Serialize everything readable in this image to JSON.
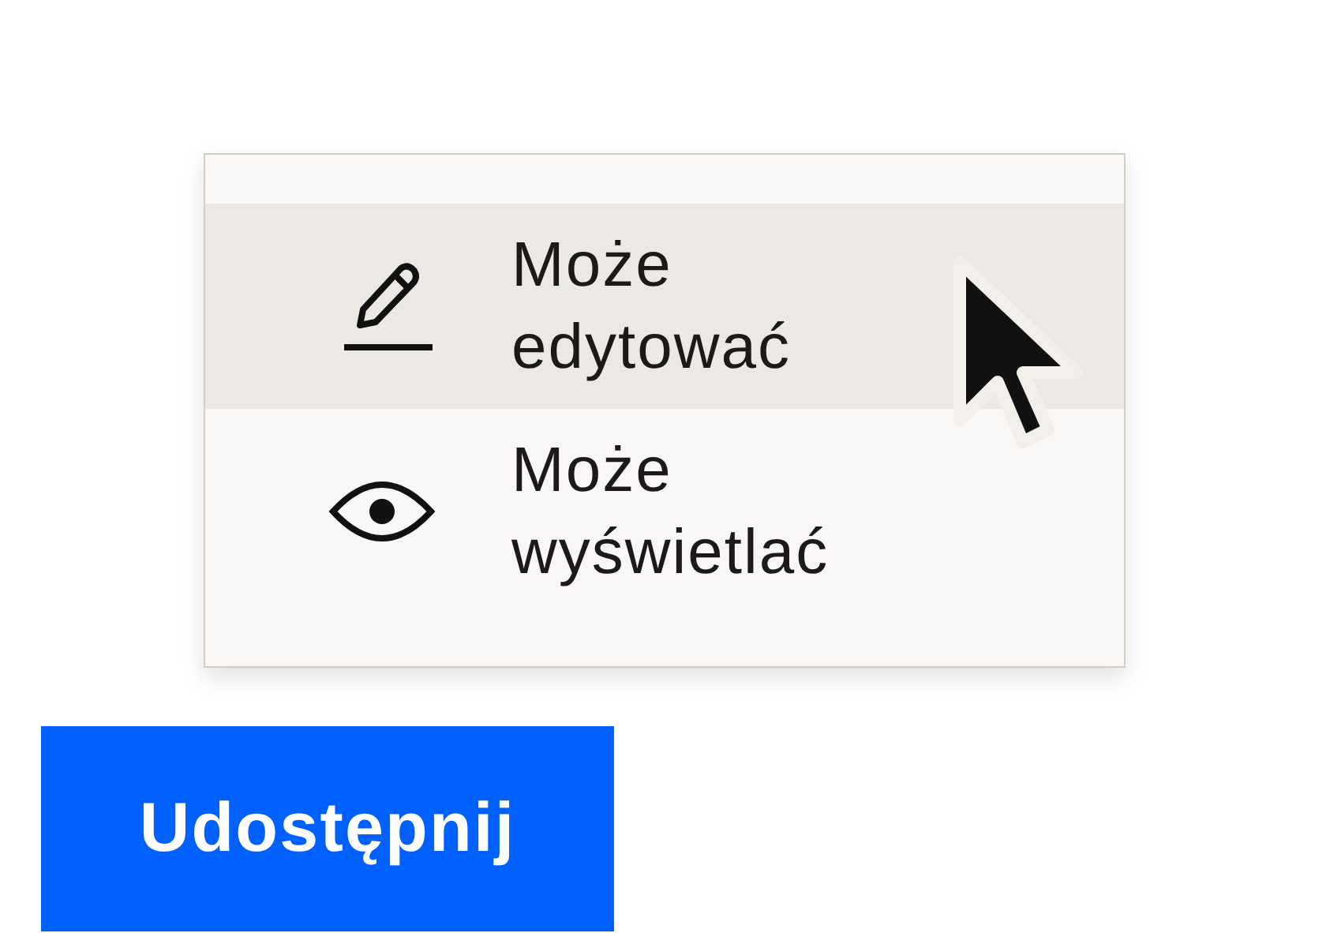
{
  "menu": {
    "items": [
      {
        "kind": "edit",
        "label": "Może edytować",
        "selected": true
      },
      {
        "kind": "view",
        "label": "Może wyświetlać",
        "selected": false
      }
    ]
  },
  "share_button": {
    "label": "Udostępnij"
  }
}
